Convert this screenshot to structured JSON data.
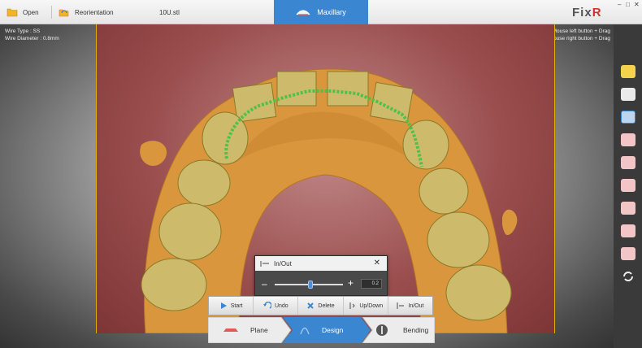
{
  "toolbar": {
    "open_label": "Open",
    "reorientation_label": "Reorientation",
    "filename": "10U.stl",
    "active_tab_label": "Maxillary",
    "logo_text": "Fix",
    "logo_accent": "R"
  },
  "window_controls": {
    "minimize": "–",
    "maximize": "□",
    "close": "✕"
  },
  "viewport": {
    "wire_type": "Wire Type : SS",
    "wire_diameter": "Wire Diameter : 0.8mm",
    "hint_rotate": "Rotate : Mouse left button + Drag",
    "hint_pan": "Pan : Mouse right button + Drag"
  },
  "inout_panel": {
    "title": "In/Out",
    "close": "✕",
    "minus": "–",
    "plus": "+",
    "value": "0.2",
    "slider_level": 0.52
  },
  "actions": [
    {
      "label": "Start",
      "icon": "play-icon"
    },
    {
      "label": "Undo",
      "icon": "undo-icon"
    },
    {
      "label": "Delete",
      "icon": "delete-icon"
    },
    {
      "label": "Up/Down",
      "icon": "updown-icon"
    },
    {
      "label": "In/Out",
      "icon": "inout-icon"
    }
  ],
  "steps": [
    {
      "label": "Plane",
      "state": "inactive"
    },
    {
      "label": "Design",
      "state": "active"
    },
    {
      "label": "Bending",
      "state": "inactive"
    }
  ],
  "right_tools": [
    "wire-tool-icon",
    "scan-tray-icon",
    "upper-arch-icon",
    "lower-arch-icon",
    "tooth-front-icon",
    "tooth-side-left-icon",
    "tooth-side-right-icon",
    "tooth-molar-icon",
    "tooth-occlusal-icon",
    "rotate-view-icon"
  ],
  "colors": {
    "accent": "#3a86d0",
    "logo_accent": "#d0312d",
    "model": "#d9963c",
    "wire": "#4cc24a",
    "background": "#9a4e4e"
  }
}
